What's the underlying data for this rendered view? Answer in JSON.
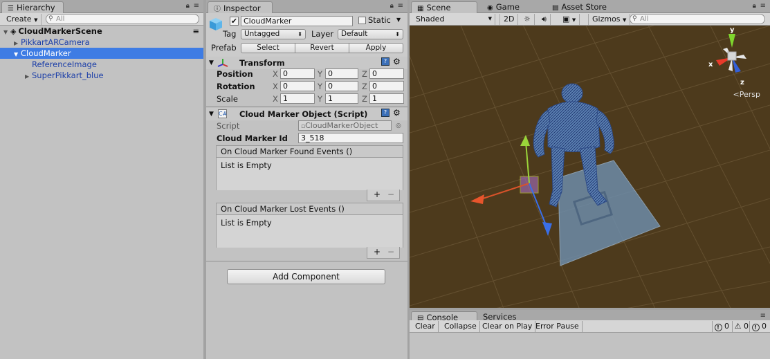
{
  "hierarchy": {
    "tab_label": "Hierarchy",
    "create_label": "Create",
    "search_placeholder": "All",
    "scene_name": "CloudMarkerScene",
    "items": [
      {
        "label": "PikkartARCamera"
      },
      {
        "label": "CloudMarker"
      },
      {
        "label": "ReferenceImage"
      },
      {
        "label": "SuperPikkart_blue"
      }
    ]
  },
  "inspector": {
    "tab_label": "Inspector",
    "object_name": "CloudMarker",
    "static_label": "Static",
    "tag_label": "Tag",
    "tag_value": "Untagged",
    "layer_label": "Layer",
    "layer_value": "Default",
    "prefab_label": "Prefab",
    "prefab_buttons": [
      "Select",
      "Revert",
      "Apply"
    ],
    "transform": {
      "title": "Transform",
      "position_label": "Position",
      "rotation_label": "Rotation",
      "scale_label": "Scale",
      "axis_x": "X",
      "axis_y": "Y",
      "axis_z": "Z",
      "position": [
        "0",
        "0",
        "0"
      ],
      "rotation": [
        "0",
        "0",
        "0"
      ],
      "scale": [
        "1",
        "1",
        "1"
      ]
    },
    "script_component": {
      "title": "Cloud Marker Object (Script)",
      "script_label": "Script",
      "script_value": "CloudMarkerObject",
      "id_label": "Cloud Marker Id",
      "id_value": "3_518",
      "found_events_title": "On Cloud Marker Found Events ()",
      "found_events_body": "List is Empty",
      "lost_events_title": "On Cloud Marker Lost Events ()",
      "lost_events_body": "List is Empty",
      "plus": "+",
      "minus": "−"
    },
    "add_component_label": "Add Component"
  },
  "scene": {
    "tabs": [
      "Scene",
      "Game",
      "Asset Store"
    ],
    "shading_mode": "Shaded",
    "mode_2d": "2D",
    "gizmos_label": "Gizmos",
    "search_placeholder": "All",
    "gizmo_labels": {
      "x": "x",
      "y": "y",
      "z": "z"
    },
    "persp_label": "Persp",
    "colors": {
      "background": "#4d3a1c",
      "grid": "#6a5636",
      "plane": "#6e8fae"
    }
  },
  "console": {
    "tabs": [
      "Console",
      "Services"
    ],
    "buttons": [
      "Clear",
      "Collapse",
      "Clear on Play",
      "Error Pause"
    ],
    "counts": {
      "info": "0",
      "warning": "0",
      "error": "0"
    }
  }
}
